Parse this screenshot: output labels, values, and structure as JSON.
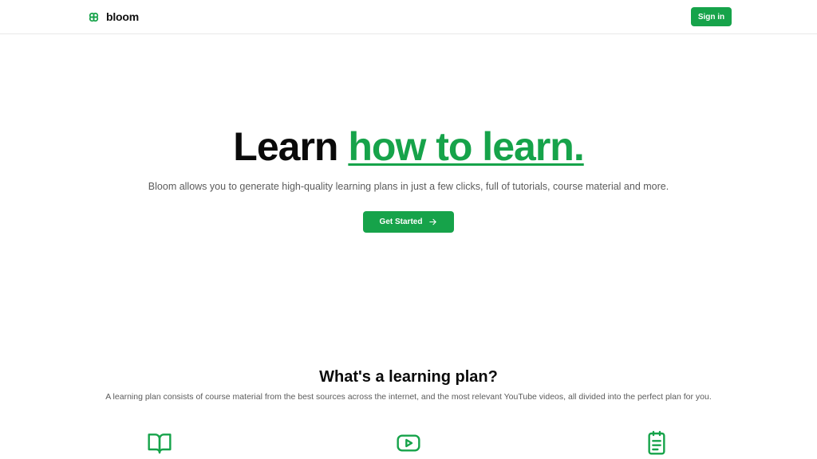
{
  "nav": {
    "brand": "bloom",
    "brand_icon": "clover-logo-icon",
    "signin_label": "Sign in"
  },
  "hero": {
    "title_plain": "Learn",
    "title_accent": "how to learn.",
    "subtitle": "Bloom allows you to generate high-quality learning plans in just a few clicks, full of tutorials, course material and more.",
    "cta_label": "Get Started",
    "cta_icon": "arrow-right-icon"
  },
  "section": {
    "title": "What's a learning plan?",
    "text": "A learning plan consists of course material from the best sources across the internet, and the most relevant YouTube videos, all divided into the perfect plan for you."
  },
  "features": {
    "icons": [
      "book-open-icon",
      "video-icon",
      "clipboard-list-icon"
    ]
  },
  "colors": {
    "accent": "#16a34a",
    "text_dark": "#0a0a0a",
    "text_muted": "#5b5b5b",
    "border": "#e8e8e8"
  }
}
